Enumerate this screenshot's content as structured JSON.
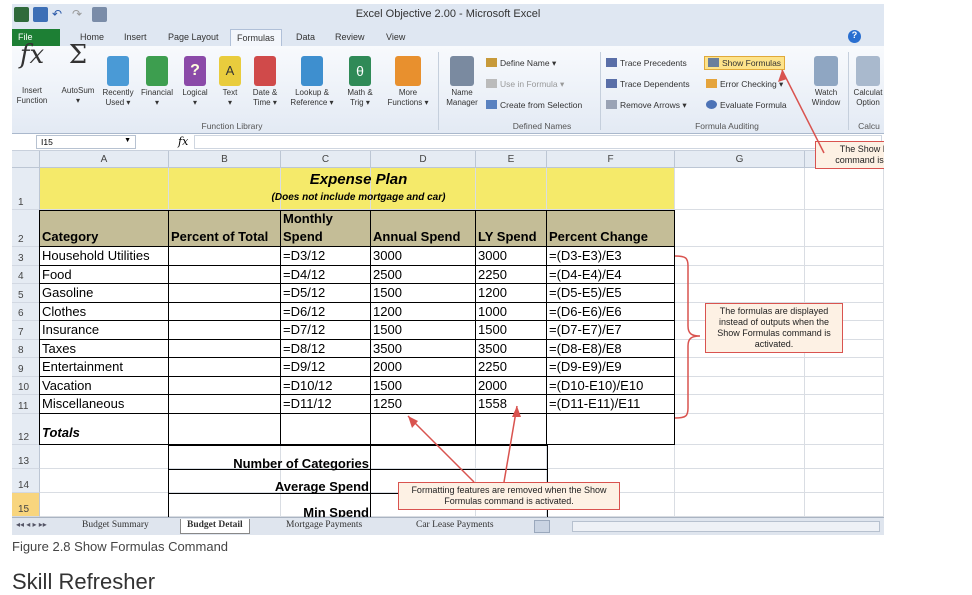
{
  "window": {
    "title": "Excel Objective 2.00 - Microsoft Excel"
  },
  "ribbon_tabs": [
    "File",
    "Home",
    "Insert",
    "Page Layout",
    "Formulas",
    "Data",
    "Review",
    "View"
  ],
  "ribbon": {
    "insert_function": [
      "Insert",
      "Function"
    ],
    "autosum": [
      "AutoSum",
      "▾"
    ],
    "recently_used": [
      "Recently",
      "Used ▾"
    ],
    "financial": [
      "Financial",
      "▾"
    ],
    "logical": [
      "Logical",
      "▾"
    ],
    "text": [
      "Text",
      "▾"
    ],
    "date_time": [
      "Date &",
      "Time ▾"
    ],
    "lookup": [
      "Lookup &",
      "Reference ▾"
    ],
    "math": [
      "Math &",
      "Trig ▾"
    ],
    "more": [
      "More",
      "Functions ▾"
    ],
    "name_manager": [
      "Name",
      "Manager"
    ],
    "define_name": "Define Name ▾",
    "use_in_formula": "Use in Formula ▾",
    "create_from_selection": "Create from Selection",
    "trace_precedents": "Trace Precedents",
    "trace_dependents": "Trace Dependents",
    "remove_arrows": "Remove Arrows ▾",
    "show_formulas": "Show Formulas",
    "error_checking": "Error Checking ▾",
    "evaluate_formula": "Evaluate Formula",
    "watch_window": [
      "Watch",
      "Window"
    ],
    "calc_options": [
      "Calculat",
      "Option"
    ],
    "groups": {
      "function_library": "Function Library",
      "defined_names": "Defined Names",
      "formula_auditing": "Formula Auditing",
      "calc": "Calcu"
    }
  },
  "formula_bar": {
    "name_box": "I15",
    "fx": "fx"
  },
  "columns": [
    "A",
    "B",
    "C",
    "D",
    "E",
    "F",
    "G"
  ],
  "rows": [
    "1",
    "2",
    "3",
    "4",
    "5",
    "6",
    "7",
    "8",
    "9",
    "10",
    "11",
    "12",
    "13",
    "14",
    "15"
  ],
  "sheet": {
    "title": "Expense Plan",
    "subtitle": "(Does not include mortgage and car)",
    "headers": {
      "category": "Category",
      "percent_total": "Percent of Total",
      "monthly_1": "Monthly",
      "monthly_2": "Spend",
      "annual": "Annual Spend",
      "ly": "LY Spend",
      "pct_change": "Percent Change"
    },
    "data": [
      [
        "Household Utilities",
        "=D3/12",
        "3000",
        "3000",
        "=(D3-E3)/E3"
      ],
      [
        "Food",
        "=D4/12",
        "2500",
        "2250",
        "=(D4-E4)/E4"
      ],
      [
        "Gasoline",
        "=D5/12",
        "1500",
        "1200",
        "=(D5-E5)/E5"
      ],
      [
        "Clothes",
        "=D6/12",
        "1200",
        "1000",
        "=(D6-E6)/E6"
      ],
      [
        "Insurance",
        "=D7/12",
        "1500",
        "1500",
        "=(D7-E7)/E7"
      ],
      [
        "Taxes",
        "=D8/12",
        "3500",
        "3500",
        "=(D8-E8)/E8"
      ],
      [
        "Entertainment",
        "=D9/12",
        "2000",
        "2250",
        "=(D9-E9)/E9"
      ],
      [
        "Vacation",
        "=D10/12",
        "1500",
        "2000",
        "=(D10-E10)/E10"
      ],
      [
        "Miscellaneous",
        "=D11/12",
        "1250",
        "1558",
        "=(D11-E11)/E11"
      ]
    ],
    "totals": "Totals",
    "stats": [
      "Number of Categories",
      "Average Spend",
      "Min Spend"
    ]
  },
  "sheet_tabs": [
    "Budget Summary",
    "Budget Detail",
    "Mortgage Payments",
    "Car Lease Payments"
  ],
  "callouts": {
    "show_formulas": "The Show Formulas command is activated.",
    "formulas_displayed": "The formulas are displayed instead of outputs when the Show Formulas command is activated.",
    "formatting_removed": "Formatting features are removed when the Show Formulas command is activated."
  },
  "caption": "Figure 2.8 Show Formulas Command",
  "section_heading": "Skill Refresher",
  "colors": {
    "file_tab": "#1d7f34",
    "title_fill": "#f5ea6a",
    "header_fill": "#c4bd97",
    "callout_border": "#d9534f",
    "callout_fill": "#fdf1e4",
    "selected_row": "#f8d57e"
  }
}
